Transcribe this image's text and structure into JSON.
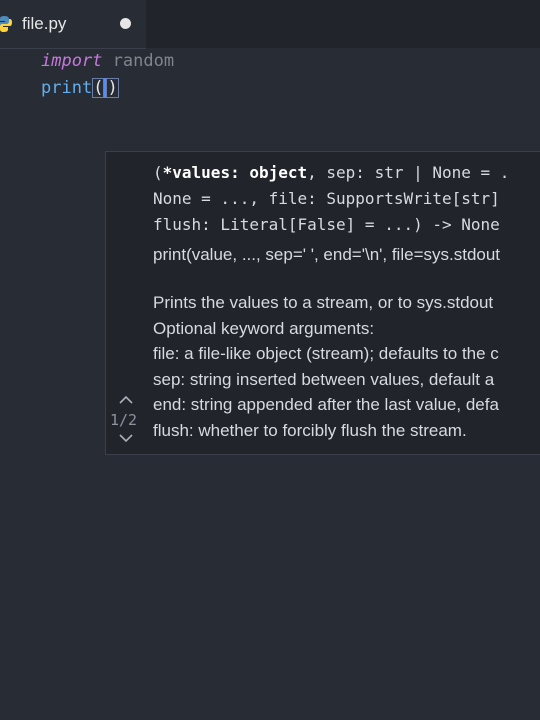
{
  "tab": {
    "icon": "python-icon",
    "filename": "file.py",
    "modified_dot": "unsaved-dot-icon"
  },
  "editor": {
    "line1": {
      "keyword": "import",
      "module": "random"
    },
    "line2": {
      "func": "print",
      "open_paren": "(",
      "close_paren": ")"
    }
  },
  "signature_help": {
    "sig_line1_start": "(",
    "sig_line1_bold": "*values: object",
    "sig_line1_rest": ", sep: str | None = .",
    "sig_line2": "None = ..., file: SupportsWrite[str]",
    "sig_line3": "flush: Literal[False] = ...) -> None",
    "usage": "print(value, ..., sep=' ', end='\\n', file=sys.stdout",
    "doc_lines": [
      "Prints the values to a stream, or to sys.stdout",
      "Optional keyword arguments:",
      "file: a file-like object (stream); defaults to the c",
      "sep: string inserted between values, default a",
      "end: string appended after the last value, defa",
      "flush: whether to forcibly flush the stream."
    ],
    "overload_counter": "1/2",
    "prev_icon": "chevron-up-icon",
    "next_icon": "chevron-down-icon"
  }
}
